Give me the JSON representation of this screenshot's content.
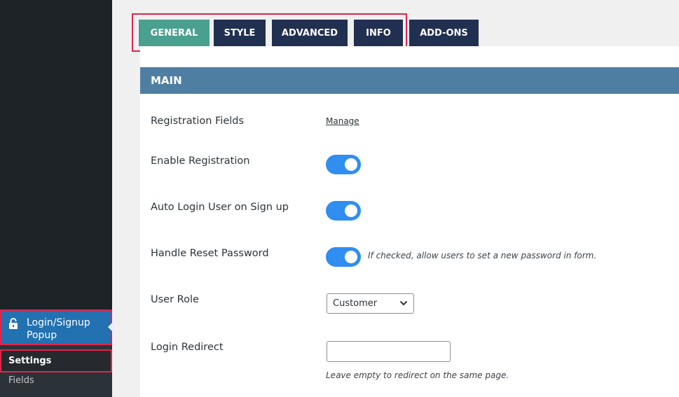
{
  "sidebar": {
    "menu_label": "Login/Signup Popup",
    "submenu": [
      {
        "label": "Settings"
      },
      {
        "label": "Fields"
      }
    ]
  },
  "tabs": [
    {
      "label": "GENERAL",
      "active": true
    },
    {
      "label": "STYLE"
    },
    {
      "label": "ADVANCED"
    },
    {
      "label": "INFO"
    },
    {
      "label": "ADD-ONS"
    }
  ],
  "section": {
    "title": "MAIN"
  },
  "fields": {
    "registration_fields": {
      "label": "Registration Fields",
      "link": "Manage"
    },
    "enable_registration": {
      "label": "Enable Registration",
      "checked": true
    },
    "auto_login": {
      "label": "Auto Login User on Sign up",
      "checked": true
    },
    "handle_reset": {
      "label": "Handle Reset Password",
      "checked": true,
      "hint": "If checked, allow users to set a new password in form."
    },
    "user_role": {
      "label": "User Role",
      "value": "Customer"
    },
    "login_redirect": {
      "label": "Login Redirect",
      "value": "",
      "hint": "Leave empty to redirect on the same page."
    }
  },
  "colors": {
    "tab_active": "#49a08e",
    "tab_inactive": "#213050",
    "section_header": "#4e7fa3",
    "toggle_on": "#2f8ef0",
    "highlight_box": "#e0254b",
    "sidebar_active": "#2271b1"
  },
  "icons": {
    "menu": "lock-icon",
    "select": "chevron-down-icon"
  }
}
